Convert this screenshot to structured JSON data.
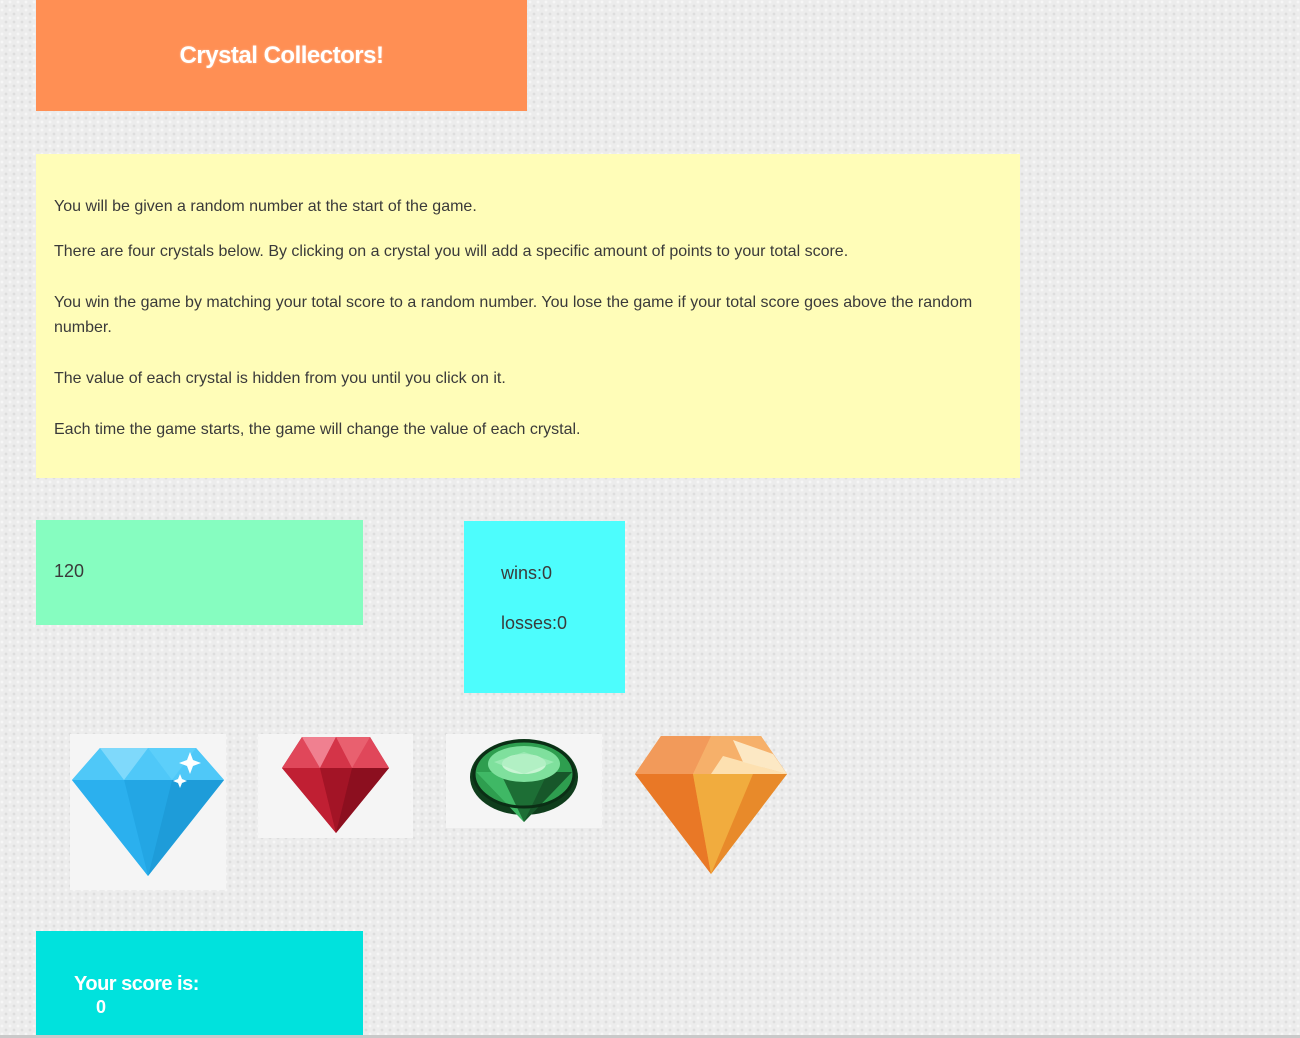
{
  "header": {
    "title": "Crystal Collectors!",
    "background": "#ff8f54"
  },
  "instructions": {
    "lines": [
      "You will be given a random number at the start of the game.",
      "There are four crystals below. By clicking on a crystal you will add a specific amount of points to your total score.",
      "You win the game by matching your total score to a random number. You lose the game if your total score goes above the random number.",
      "The value of each crystal is hidden from you until you click on it.",
      "Each time the game starts, the game will change the value of each crystal."
    ]
  },
  "target": {
    "value": "120"
  },
  "stats": {
    "wins": "wins:0",
    "losses": "losses:0"
  },
  "crystals": [
    {
      "name": "blue-diamond-icon",
      "color": "#29b6f6"
    },
    {
      "name": "red-ruby-icon",
      "color": "#c62234"
    },
    {
      "name": "green-emerald-icon",
      "color": "#2e9e4f"
    },
    {
      "name": "orange-topaz-icon",
      "color": "#f3a23a"
    }
  ],
  "score": {
    "label": "Your score is:",
    "value": "0"
  }
}
